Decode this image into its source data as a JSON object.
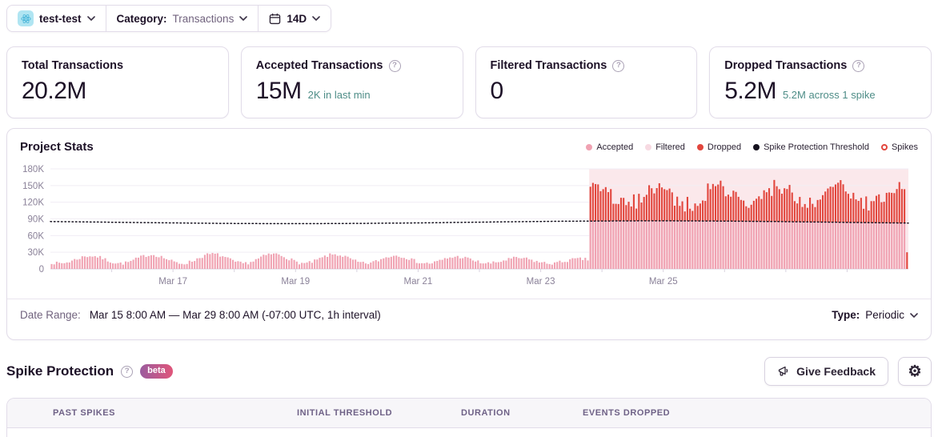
{
  "topbar": {
    "project": {
      "name": "test-test",
      "icon": "react-atom-icon"
    },
    "category_label": "Category:",
    "category_value": "Transactions",
    "date_button_label": "14D"
  },
  "cards": [
    {
      "title": "Total Transactions",
      "value": "20.2M",
      "subtext": "",
      "has_help": false
    },
    {
      "title": "Accepted Transactions",
      "value": "15M",
      "subtext": "2K in last min",
      "has_help": true
    },
    {
      "title": "Filtered Transactions",
      "value": "0",
      "subtext": "",
      "has_help": true
    },
    {
      "title": "Dropped Transactions",
      "value": "5.2M",
      "subtext": "5.2M across 1 spike",
      "has_help": true
    }
  ],
  "chart_panel": {
    "title": "Project Stats",
    "legend": [
      {
        "label": "Accepted",
        "color": "#f0a2b2",
        "shape": "dot"
      },
      {
        "label": "Filtered",
        "color": "#f7dae2",
        "shape": "dot"
      },
      {
        "label": "Dropped",
        "color": "#e2463d",
        "shape": "dot"
      },
      {
        "label": "Spike Protection Threshold",
        "color": "#16121f",
        "shape": "dot"
      },
      {
        "label": "Spikes",
        "color": "#e2463d",
        "shape": "ring"
      }
    ],
    "footer": {
      "date_range_label": "Date Range:",
      "date_range_value": "Mar 15 8:00 AM — Mar 29 8:00 AM (-07:00 UTC, 1h interval)",
      "type_label": "Type:",
      "type_value": "Periodic"
    }
  },
  "chart_data": {
    "type": "bar",
    "title": "Project Stats",
    "interval": "1h",
    "hours_total": 336,
    "x_start": "Mar 15 8:00 AM",
    "x_end": "Mar 29 8:00 AM",
    "ylim": [
      0,
      180000
    ],
    "yticks": [
      {
        "value": 0,
        "label": "0"
      },
      {
        "value": 30000,
        "label": "30K"
      },
      {
        "value": 60000,
        "label": "60K"
      },
      {
        "value": 90000,
        "label": "90K"
      },
      {
        "value": 120000,
        "label": "120K"
      },
      {
        "value": 150000,
        "label": "150K"
      },
      {
        "value": 180000,
        "label": "180K"
      }
    ],
    "x_tick_every_hours": 24,
    "x_labels": [
      {
        "hour": 48,
        "label": "Mar 17"
      },
      {
        "hour": 96,
        "label": "Mar 19"
      },
      {
        "hour": 144,
        "label": "Mar 21"
      },
      {
        "hour": 192,
        "label": "Mar 23"
      },
      {
        "hour": 240,
        "label": "Mar 25"
      }
    ],
    "series_colors": {
      "accepted": "#f0a2b2",
      "dropped": "#e2463d",
      "threshold": "#16121f",
      "spike_region": "#fbe8eb",
      "grid": "#f1edf4",
      "axis": "#d9d3e0",
      "tick_label": "#8b8299"
    },
    "threshold": {
      "base": 84000,
      "wave_amp": 2500,
      "description": "dotted spike-protection threshold ~82K-86K across full range"
    },
    "pre_spike": {
      "accepted_hourly_range": [
        7000,
        30000
      ],
      "dropped": 0,
      "pattern": "daily cycle, accepted only"
    },
    "spike": {
      "start_hour": 211,
      "end_hour": 335,
      "accepted_capped_at_threshold": true,
      "total_hourly_range": [
        100000,
        168000
      ],
      "dropped_total_label": "5.2M",
      "spike_count": 1
    },
    "last_bar": {
      "hour": 335,
      "dropped_only_value": 30000
    },
    "seed": 7
  },
  "spike_section": {
    "title": "Spike Protection",
    "beta_badge": "beta",
    "feedback_button": "Give Feedback"
  },
  "table": {
    "headers": [
      "Past Spikes",
      "Initial Threshold",
      "Duration",
      "Events Dropped"
    ]
  },
  "colors": {
    "text": "#1d1127",
    "muted_text": "#71637e",
    "border": "#e2dce9",
    "subtext_teal": "#4e8d87",
    "beta_gradient": [
      "#9a5c9e",
      "#e0557a"
    ],
    "table_header_bg": "#f7f6f9"
  }
}
